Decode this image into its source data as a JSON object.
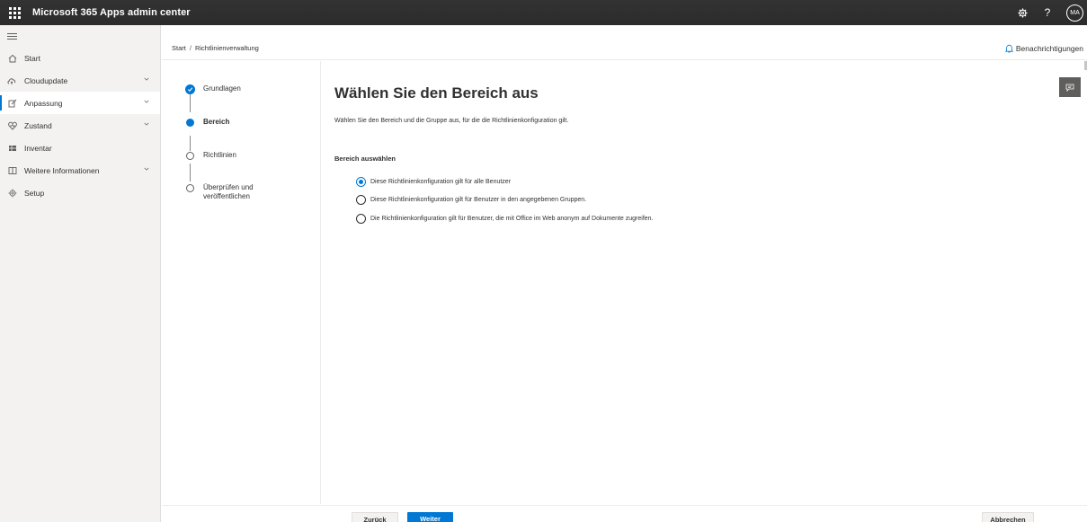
{
  "app": {
    "title": "Microsoft 365 Apps admin center",
    "avatar_initials": "MA"
  },
  "icons": {
    "app_launcher": "waffle-icon",
    "settings": "gear-icon",
    "help": "question-icon",
    "notifications": "bell-icon",
    "feedback": "feedback-icon"
  },
  "breadcrumb": {
    "items": [
      "Start",
      "Richtlinienverwaltung"
    ],
    "separator": "/"
  },
  "notifications_label": "Benachrichtigungen",
  "sidebar": {
    "items": [
      {
        "label": "Start",
        "icon": "home-icon",
        "chevron": false,
        "active": false
      },
      {
        "label": "Cloudupdate",
        "icon": "cloud-update-icon",
        "chevron": true,
        "active": false
      },
      {
        "label": "Anpassung",
        "icon": "edit-icon",
        "chevron": true,
        "active": true
      },
      {
        "label": "Zustand",
        "icon": "health-icon",
        "chevron": true,
        "active": false
      },
      {
        "label": "Inventar",
        "icon": "inventory-icon",
        "chevron": false,
        "active": false
      },
      {
        "label": "Weitere Informationen",
        "icon": "book-icon",
        "chevron": true,
        "active": false
      },
      {
        "label": "Setup",
        "icon": "setup-icon",
        "chevron": false,
        "active": false
      }
    ]
  },
  "wizard": {
    "steps": [
      {
        "label": "Grundlagen",
        "state": "done"
      },
      {
        "label": "Bereich",
        "state": "current"
      },
      {
        "label": "Richtlinien",
        "state": "todo"
      },
      {
        "label": "Überprüfen und veröffentlichen",
        "state": "todo"
      }
    ]
  },
  "main": {
    "heading": "Wählen Sie den Bereich aus",
    "description": "Wählen Sie den Bereich und die Gruppe aus, für die die Richtlinienkonfiguration gilt.",
    "section_label": "Bereich auswählen",
    "options": [
      {
        "label": "Diese Richtlinienkonfiguration gilt für alle Benutzer",
        "selected": true
      },
      {
        "label": "Diese Richtlinienkonfiguration gilt für Benutzer in den angegebenen Gruppen.",
        "selected": false
      },
      {
        "label": "Die Richtlinienkonfiguration gilt für Benutzer, die mit Office im Web anonym auf Dokumente zugreifen.",
        "selected": false
      }
    ]
  },
  "footer": {
    "back_label": "Zurück",
    "next_label": "Weiter",
    "cancel_label": "Abbrechen"
  },
  "colors": {
    "accent": "#0078d4",
    "topbar": "#2d2d2d",
    "nav_bg": "#f3f2f1"
  }
}
